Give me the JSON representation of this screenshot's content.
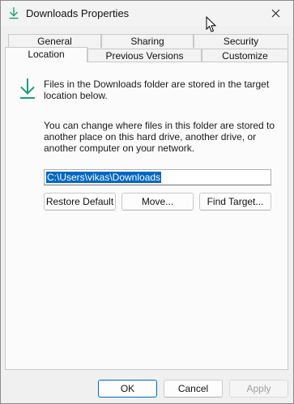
{
  "window": {
    "title": "Downloads Properties"
  },
  "tabs": {
    "row1": [
      "General",
      "Sharing",
      "Security"
    ],
    "row2": [
      "Location",
      "Previous Versions",
      "Customize"
    ],
    "active": "Location"
  },
  "location": {
    "intro": "Files in the Downloads folder are stored in the target location below.",
    "description": "You can change where files in this folder are stored to another place on this hard drive, another drive, or another computer on your network.",
    "path_value": "C:\\Users\\vikas\\Downloads",
    "buttons": {
      "restore_default": "Restore Default",
      "move": "Move...",
      "find_target": "Find Target..."
    }
  },
  "footer": {
    "ok": "OK",
    "cancel": "Cancel",
    "apply": "Apply"
  },
  "colors": {
    "accent": "#0067c0",
    "download_icon": "#1e9e78"
  }
}
